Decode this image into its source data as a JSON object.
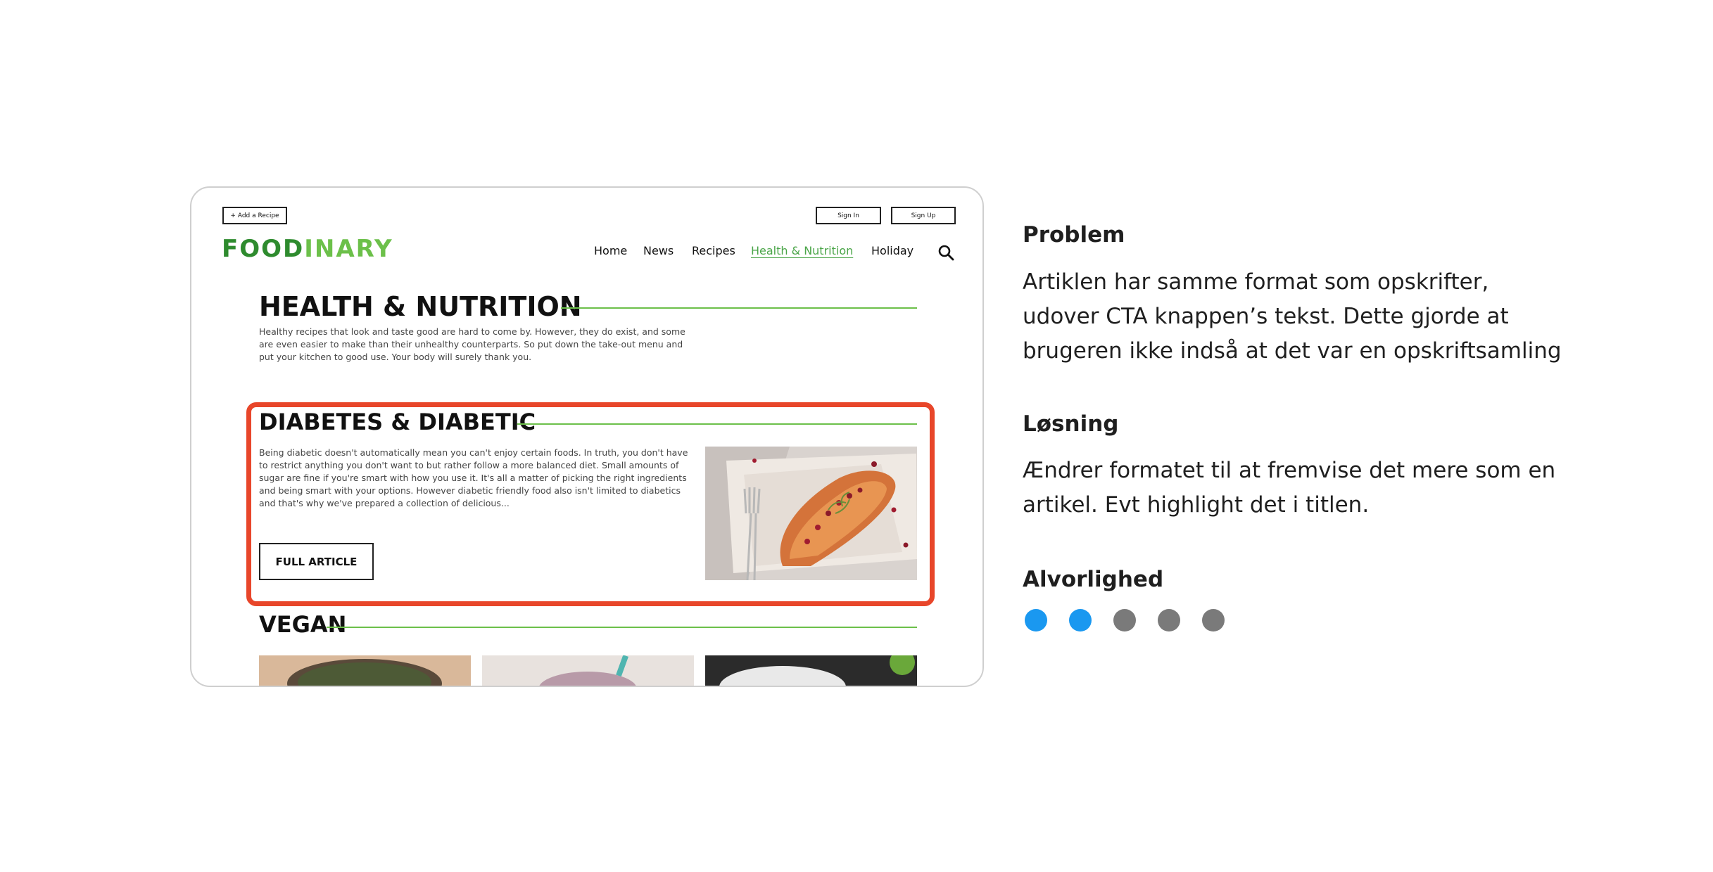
{
  "mockup": {
    "top_buttons": {
      "add_recipe": "+ Add a Recipe",
      "sign_in": "Sign In",
      "sign_up": "Sign Up"
    },
    "logo": {
      "part1": "FOOD",
      "part2": "INARY"
    },
    "nav": [
      "Home",
      "News",
      "Recipes",
      "Health & Nutrition",
      "Holiday"
    ],
    "nav_active": "Health & Nutrition",
    "page_title": "HEALTH & NUTRITION",
    "intro": "Healthy recipes that look and taste good are hard to come by. However, they do exist, and some are even easier to make than their unhealthy counterparts. So put down the take-out menu and put your kitchen to good use. Your body will surely thank you.",
    "article": {
      "title": "DIABETES & DIABETIC",
      "text": "Being diabetic doesn't automatically mean you can't enjoy certain foods. In truth, you don't have to restrict anything you don't want to but rather follow a more balanced diet. Small amounts of sugar are fine if you're smart with how you use it. It's all a matter of picking the right ingredients and being smart with your options. However diabetic friendly food also isn't limited to diabetics and that's why we've prepared a collection of delicious...",
      "button": "FULL ARTICLE"
    },
    "next_section": "VEGAN"
  },
  "panel": {
    "problem": {
      "heading": "Problem",
      "text": "Artiklen har samme format som opskrifter, udover CTA knappen’s tekst. Dette gjorde at brugeren ikke indså at det var en opskriftsamling"
    },
    "solution": {
      "heading": "Løsning",
      "text": "Ændrer formatet til at fremvise det mere som en artikel. Evt highlight det i titlen."
    },
    "severity": {
      "heading": "Alvorlighed",
      "level": 2,
      "max": 5,
      "active_color": "#1a98f0",
      "inactive_color": "#7a7a7a"
    }
  },
  "colors": {
    "brand_green": "#2e8b2e",
    "accent_green": "#6cc04a",
    "highlight_red": "#e8462a"
  }
}
